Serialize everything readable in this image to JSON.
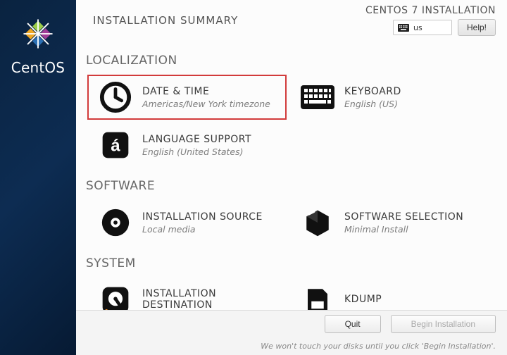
{
  "brand": "CentOS",
  "header": {
    "title": "INSTALLATION SUMMARY",
    "subtitle": "CENTOS 7 INSTALLATION",
    "keyboard_layout": "us",
    "help_label": "Help!"
  },
  "sections": {
    "localization": {
      "heading": "LOCALIZATION",
      "date_time": {
        "label": "DATE & TIME",
        "status": "Americas/New York timezone"
      },
      "keyboard": {
        "label": "KEYBOARD",
        "status": "English (US)"
      },
      "language_support": {
        "label": "LANGUAGE SUPPORT",
        "status": "English (United States)"
      }
    },
    "software": {
      "heading": "SOFTWARE",
      "installation_source": {
        "label": "INSTALLATION SOURCE",
        "status": "Local media"
      },
      "software_selection": {
        "label": "SOFTWARE SELECTION",
        "status": "Minimal Install"
      }
    },
    "system": {
      "heading": "SYSTEM",
      "installation_destination": {
        "label": "INSTALLATION DESTINATION",
        "status": ""
      },
      "kdump": {
        "label": "KDUMP",
        "status": ""
      }
    }
  },
  "footer": {
    "quit_label": "Quit",
    "begin_label": "Begin Installation",
    "hint": "We won't touch your disks until you click 'Begin Installation'."
  },
  "colors": {
    "highlight": "#d23b3b"
  }
}
